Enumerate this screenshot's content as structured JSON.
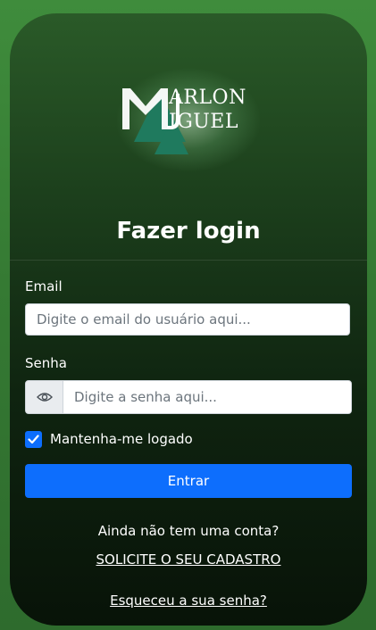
{
  "logo": {
    "line1": "ARLON",
    "line2": "IGUEL",
    "colors": {
      "glow": "#c8ebc8",
      "triangle": "#1f7a5e",
      "mark": "#ffffff"
    }
  },
  "form": {
    "title": "Fazer login",
    "email": {
      "label": "Email",
      "placeholder": "Digite o email do usuário aqui..."
    },
    "password": {
      "label": "Senha",
      "placeholder": "Digite a senha aqui...",
      "toggle_icon": "eye-icon"
    },
    "remember": {
      "label": "Mantenha-me logado",
      "checked": true
    },
    "submit_label": "Entrar"
  },
  "footer": {
    "no_account_text": "Ainda não tem uma conta?",
    "register_link": "SOLICITE O SEU CADASTRO",
    "forgot_link": "Esqueceu a sua senha?"
  },
  "colors": {
    "accent": "#0d6efd",
    "background": "#3f8c3c",
    "card_top": "#2a5a28",
    "card_bottom": "#081308"
  }
}
